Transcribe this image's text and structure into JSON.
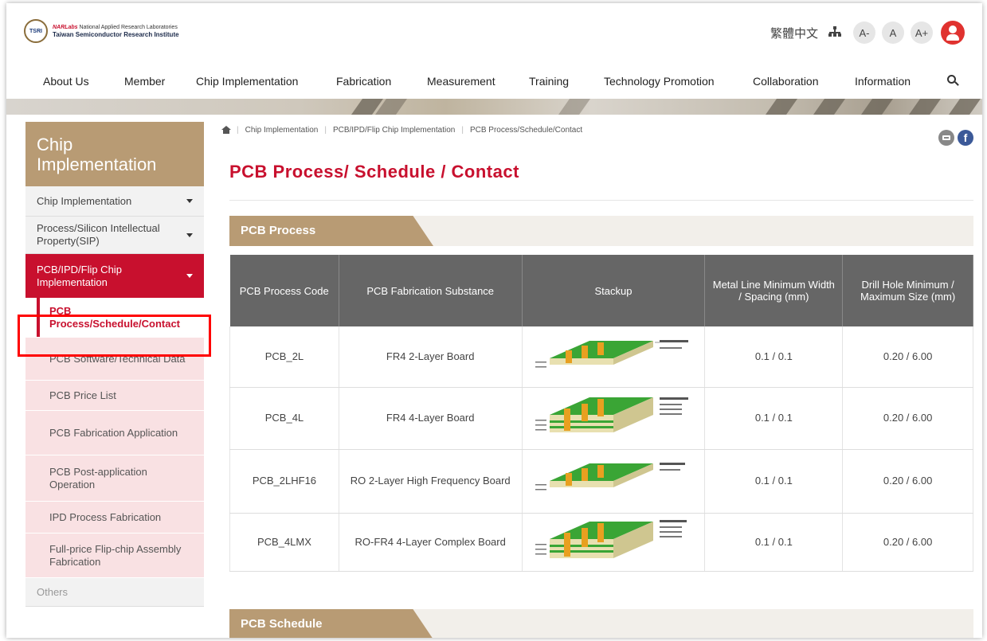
{
  "header": {
    "logo_seal": "TSRI",
    "logo_line1_brand": "NARLabs",
    "logo_line1": "National Applied Research Laboratories",
    "logo_line2": "Taiwan Semiconductor Research Institute",
    "language": "繁體中文",
    "font_small": "A-",
    "font_normal": "A",
    "font_large": "A+"
  },
  "nav": {
    "items": [
      "About Us",
      "Member",
      "Chip Implementation",
      "Fabrication",
      "Measurement",
      "Training",
      "Technology Promotion",
      "Collaboration",
      "Information"
    ]
  },
  "sidebar": {
    "title": "Chip Implementation",
    "items": [
      {
        "label": "Chip Implementation"
      },
      {
        "label": "Process/Silicon Intellectual Property(SIP)"
      },
      {
        "label": "PCB/IPD/Flip Chip Implementation"
      }
    ],
    "sub_items": [
      {
        "label": "PCB Process/Schedule/Contact"
      },
      {
        "label": "PCB Software/Technical Data"
      },
      {
        "label": "PCB Price List"
      },
      {
        "label": "PCB Fabrication Application"
      },
      {
        "label": "PCB Post-application Operation"
      },
      {
        "label": "IPD Process Fabrication"
      },
      {
        "label": "Full-price Flip-chip Assembly Fabrication"
      }
    ],
    "others": "Others"
  },
  "breadcrumb": [
    "Chip Implementation",
    "PCB/IPD/Flip Chip Implementation",
    "PCB Process/Schedule/Contact"
  ],
  "page_title": "PCB Process/ Schedule / Contact",
  "sections": {
    "process": "PCB Process",
    "schedule": "PCB Schedule"
  },
  "table": {
    "headers": [
      "PCB Process Code",
      "PCB Fabrication Substance",
      "Stackup",
      "Metal Line Minimum Width / Spacing (mm)",
      "Drill Hole Minimum / Maximum Size (mm)"
    ],
    "rows": [
      {
        "code": "PCB_2L",
        "substance": "FR4 2-Layer Board",
        "metal": "0.1 / 0.1",
        "drill": "0.20 / 6.00"
      },
      {
        "code": "PCB_4L",
        "substance": "FR4 4-Layer Board",
        "metal": "0.1 / 0.1",
        "drill": "0.20 / 6.00"
      },
      {
        "code": "PCB_2LHF16",
        "substance": "RO 2-Layer High Frequency Board",
        "metal": "0.1 / 0.1",
        "drill": "0.20 / 6.00"
      },
      {
        "code": "PCB_4LMX",
        "substance": "RO-FR4 4-Layer Complex Board",
        "metal": "0.1 / 0.1",
        "drill": "0.20 / 6.00"
      }
    ]
  },
  "colors": {
    "brand_red": "#c8102e",
    "tan": "#b89b74",
    "table_header": "#666666"
  }
}
